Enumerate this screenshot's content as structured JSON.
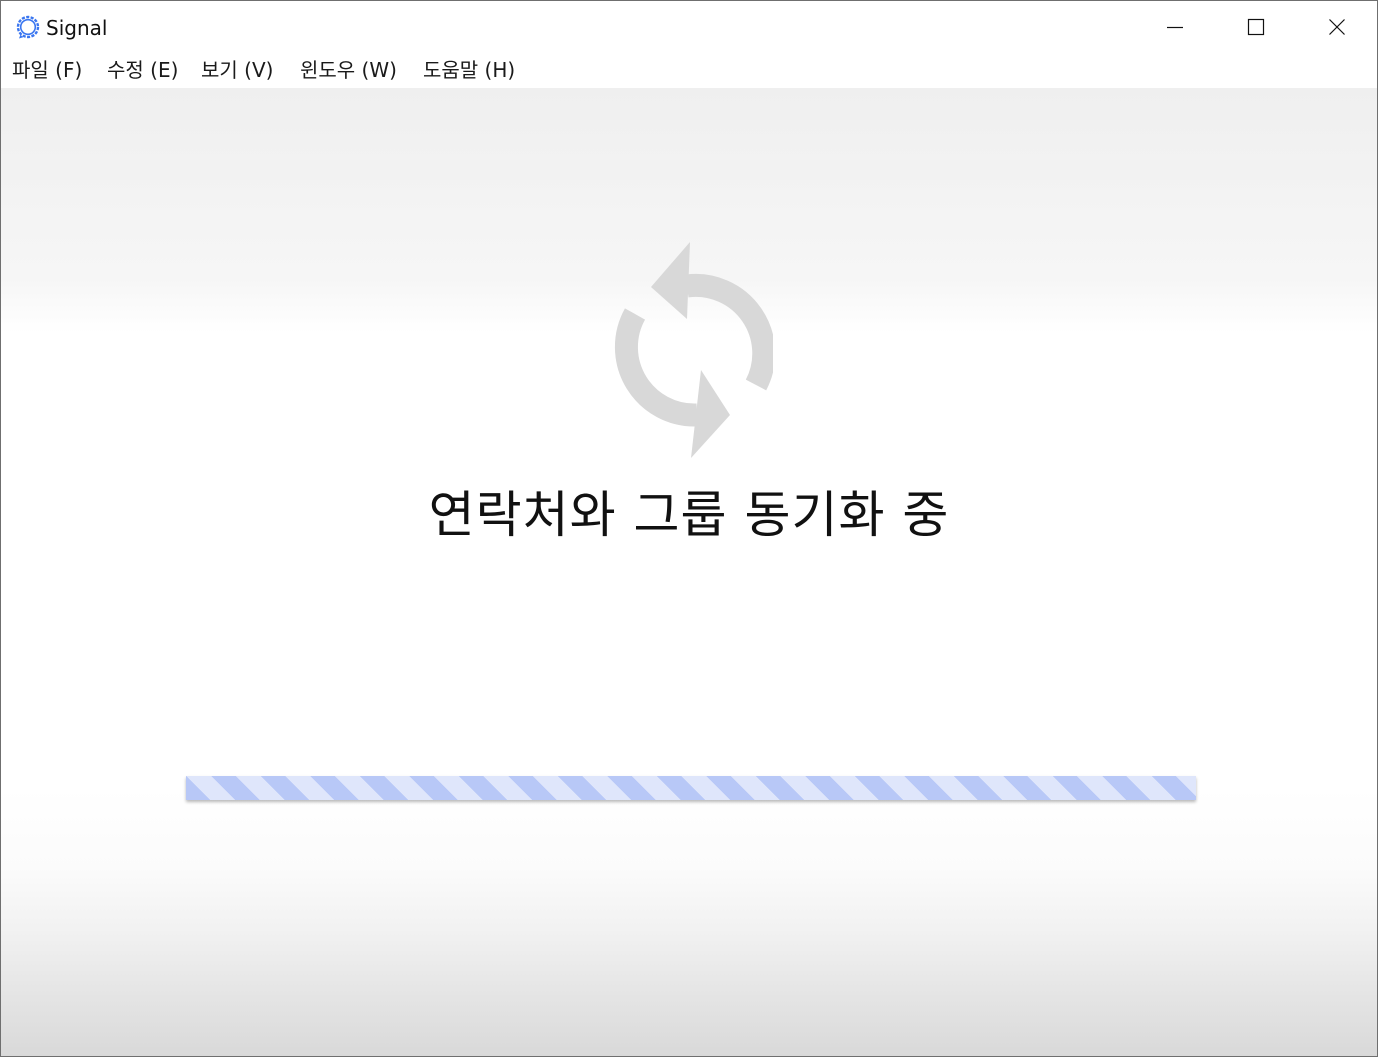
{
  "window": {
    "title": "Signal",
    "app_icon": "signal-app-icon",
    "controls": [
      "minimize-icon",
      "maximize-icon",
      "close-icon"
    ]
  },
  "menu": {
    "items": [
      {
        "label": "파일 (F)"
      },
      {
        "label": "수정 (E)"
      },
      {
        "label": "보기 (V)"
      },
      {
        "label": "윈도우 (W)"
      },
      {
        "label": "도움말 (H)"
      }
    ]
  },
  "main": {
    "icon": "sync-icon",
    "message": "연락처와 그룹 동기화 중",
    "progress": {
      "fraction": 1
    }
  },
  "colors": {
    "window_background": "#ffffff",
    "sync_icon": "#d8d8d8",
    "progress_stripe_dark": "#b8c8f7",
    "progress_stripe_light": "#dfe6fb",
    "signal_brand": "#3a76f0"
  }
}
